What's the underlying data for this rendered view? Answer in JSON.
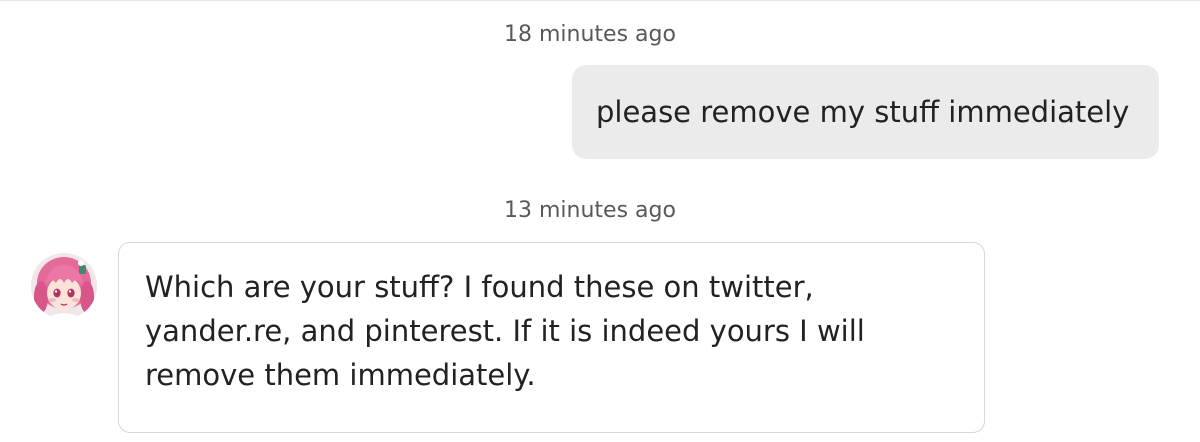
{
  "conversation": {
    "messages": [
      {
        "timestamp": "18 minutes ago",
        "direction": "outgoing",
        "text": "please remove my stuff immediately"
      },
      {
        "timestamp": "13 minutes ago",
        "direction": "incoming",
        "lines": [
          "Which are your stuff? I found these on twitter,",
          "yander.re, and pinterest. If it is indeed yours I will",
          "remove them immediately."
        ]
      }
    ]
  },
  "colors": {
    "outgoing_bubble": "#ebebeb",
    "incoming_bubble_border": "#d8d8d8",
    "timestamp_text": "#595959",
    "message_text": "#222222"
  },
  "icons": {
    "avatar": "anime-girl-avatar-icon"
  }
}
